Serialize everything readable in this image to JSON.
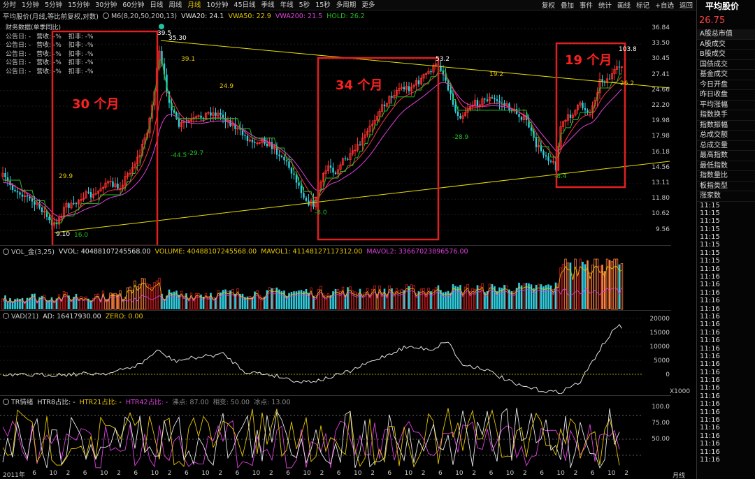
{
  "toolbar": {
    "timeframes": [
      "分时",
      "1分钟",
      "5分钟",
      "15分钟",
      "30分钟",
      "60分钟",
      "日线",
      "周线",
      "月线",
      "10分钟",
      "45日线",
      "季线",
      "年线",
      "5秒",
      "15秒",
      "多周期",
      "更多"
    ],
    "active": "月线",
    "tools": [
      "复权",
      "叠加",
      "事件",
      "统计",
      "画线",
      "标记",
      "+自选",
      "返回"
    ]
  },
  "info_bar": {
    "name": "平均股价(月线,等比前复权,对数)",
    "indicator": "M6(8,20,50,200,13)",
    "vwa20": "VWA20: 24.1",
    "vwa50": "VWA50: 22.9",
    "vwa200": "VWA200: 21.5",
    "hold": "HOLD: 26.2",
    "colors": {
      "vwa20": "#e0e0e0",
      "vwa50": "#e8c800",
      "vwa200": "#e040e0",
      "hold": "#20c020"
    }
  },
  "financial": {
    "title": "财务数据(单季同比)",
    "rows": [
      {
        "date": "公告日: -",
        "rev": "营收: -%",
        "exc": "扣非: -%"
      },
      {
        "date": "公告日: -",
        "rev": "营收: -%",
        "exc": "扣非: -%"
      },
      {
        "date": "公告日: -",
        "rev": "营收: -%",
        "exc": "扣非: -%"
      },
      {
        "date": "公告日: -",
        "rev": "营收: -%",
        "exc": "扣非: -%"
      },
      {
        "date": "公告日: -",
        "rev": "营收: -%",
        "exc": "扣非: -%"
      }
    ]
  },
  "price_axis": [
    "36.84",
    "33.50",
    "30.45",
    "27.41",
    "24.66",
    "22.20",
    "19.98",
    "17.98",
    "16.18",
    "14.56",
    "13.11",
    "11.80",
    "10.62",
    "9.56"
  ],
  "annotations": {
    "box1": "30 个月",
    "box2": "34 个月",
    "box3": "19 个月",
    "high1": "39.5",
    "high1b": "35.30",
    "v391": "39.1",
    "v249": "24.9",
    "v299": "29.9",
    "v445": "-44.5",
    "v297": "-29.7",
    "low1": "9.10",
    "low1b": "16.0",
    "v480": "-8.0",
    "v532": "53.2",
    "v192": "19.2",
    "v289": "-28.9",
    "v384": "-8.4",
    "v1038": "103.8",
    "v262": "26.2"
  },
  "vol_panel": {
    "title": "VOL_金(3,25)",
    "vvol": "VVOL: 40488107245568.00",
    "volume": "VOLUME: 40488107245568.00",
    "mavol1": "MAVOL1: 41148127117312.00",
    "mavol2": "MAVOL2: 33667023896576.00"
  },
  "vad_panel": {
    "title": "VAD(21)",
    "ad": "AD: 16417930.00",
    "zero": "ZERO: 0.00",
    "axis": [
      "20000",
      "15000",
      "10000",
      "5000",
      "0"
    ],
    "unit": "X1000"
  },
  "tr_panel": {
    "title": "TR情绪",
    "htr8": "HTR8占比: -",
    "htr21": "HTR21占比: -",
    "htr42": "HTR42占比: -",
    "boil": "沸点: 87.00",
    "phase": "相变: 50.00",
    "ice": "冰点: 13.00",
    "axis": [
      "100.0",
      "75.00",
      "50.00"
    ]
  },
  "x_axis": {
    "labels": [
      "2011年",
      "6",
      "10",
      "2",
      "6",
      "10",
      "2",
      "6",
      "10",
      "2",
      "6",
      "10",
      "2",
      "6",
      "10",
      "2",
      "6",
      "10",
      "2",
      "6",
      "10",
      "2",
      "6",
      "10",
      "2",
      "6",
      "10",
      "2",
      "6",
      "10",
      "2",
      "6",
      "10",
      "2",
      "6",
      "10",
      "2"
    ],
    "period": "月线"
  },
  "right_panel": {
    "title": "平均股价",
    "price": "26.75",
    "items": [
      "A股总市值",
      "A股成交",
      "B股成交",
      "国债成交",
      "基金成交",
      "今日开盘",
      "昨日收盘",
      "平均涨幅",
      "指数换手",
      "指数振幅",
      "总成交额",
      "总成交量",
      "最高指数",
      "最低指数",
      "指数量比",
      "板指类型",
      "涨家数"
    ],
    "times": [
      "11:15",
      "11:15",
      "11:15",
      "11:15",
      "11:15",
      "11:15",
      "11:15",
      "11:15",
      "11:16",
      "11:16",
      "11:16",
      "11:16",
      "11:16",
      "11:16",
      "11:16",
      "11:16",
      "11:16",
      "11:16",
      "11:16",
      "11:16",
      "11:16",
      "11:16",
      "11:16",
      "11:16",
      "11:16",
      "11:16",
      "11:16",
      "11:16",
      "11:16",
      "11:16",
      "11:16",
      "11:16",
      "11:16"
    ]
  }
}
